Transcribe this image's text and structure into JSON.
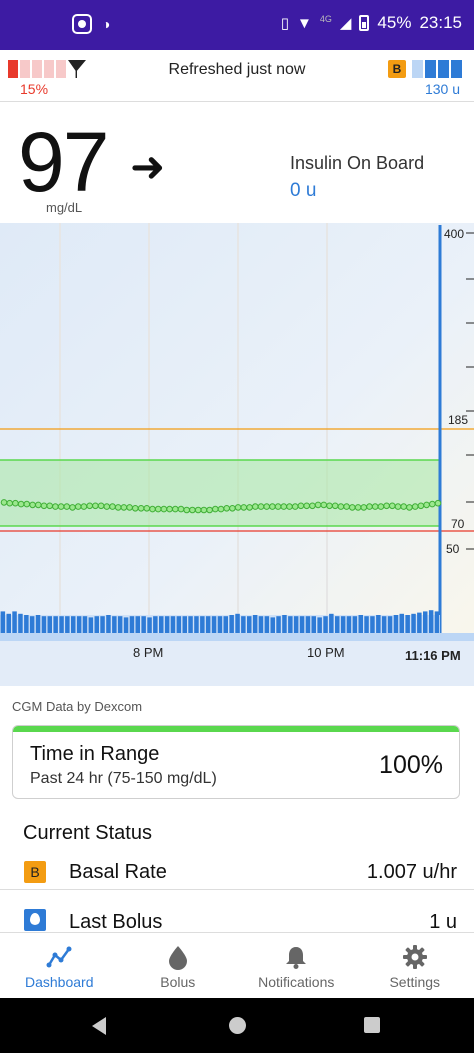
{
  "status_bar": {
    "battery_percent": "45%",
    "time": "23:15",
    "network": "4G"
  },
  "header": {
    "cgm_battery": "15%",
    "refresh_status": "Refreshed just now",
    "basal_badge": "B",
    "insulin_remaining": "130 u"
  },
  "reading": {
    "glucose": "97",
    "unit": "mg/dL",
    "trend_arrow": "➜",
    "iob_label": "Insulin On Board",
    "iob_value": "0 u"
  },
  "chart_data": {
    "type": "line",
    "y_ticks": [
      "400",
      "185",
      "70",
      "50"
    ],
    "x_ticks": [
      "8 PM",
      "10 PM",
      "11:16 PM"
    ],
    "target_high": 185,
    "target_low": 70,
    "glucose_values": [
      98,
      97,
      97,
      96,
      96,
      95,
      95,
      94,
      94,
      93,
      93,
      93,
      92,
      93,
      93,
      94,
      94,
      94,
      93,
      93,
      92,
      92,
      92,
      91,
      91,
      91,
      90,
      90,
      90,
      90,
      90,
      90,
      89,
      89,
      89,
      89,
      89,
      90,
      90,
      91,
      91,
      92,
      92,
      92,
      93,
      93,
      93,
      93,
      93,
      93,
      93,
      93,
      94,
      94,
      94,
      95,
      95,
      94,
      94,
      93,
      93,
      92,
      92,
      92,
      93,
      93,
      93,
      94,
      94,
      93,
      93,
      92,
      93,
      94,
      95,
      96,
      97
    ],
    "basal_bars": [
      0.9,
      0.8,
      0.9,
      0.8,
      0.75,
      0.7,
      0.75,
      0.7,
      0.7,
      0.7,
      0.7,
      0.7,
      0.7,
      0.7,
      0.7,
      0.65,
      0.7,
      0.7,
      0.75,
      0.7,
      0.7,
      0.65,
      0.7,
      0.7,
      0.7,
      0.65,
      0.7,
      0.7,
      0.7,
      0.7,
      0.7,
      0.7,
      0.7,
      0.7,
      0.7,
      0.7,
      0.7,
      0.7,
      0.7,
      0.75,
      0.8,
      0.7,
      0.7,
      0.75,
      0.7,
      0.7,
      0.65,
      0.7,
      0.75,
      0.7,
      0.7,
      0.7,
      0.7,
      0.7,
      0.65,
      0.7,
      0.8,
      0.7,
      0.7,
      0.7,
      0.7,
      0.75,
      0.7,
      0.7,
      0.75,
      0.7,
      0.7,
      0.75,
      0.8,
      0.75,
      0.8,
      0.85,
      0.9,
      0.95,
      0.9
    ]
  },
  "cgm_source": "CGM Data by Dexcom",
  "time_in_range": {
    "title": "Time in Range",
    "subtitle": "Past 24 hr (75-150 mg/dL)",
    "value": "100%"
  },
  "current_status": {
    "title": "Current Status",
    "basal_badge": "B",
    "basal_label": "Basal Rate",
    "basal_value": "1.007 u/hr",
    "bolus_label": "Last Bolus",
    "bolus_value": "1 u"
  },
  "bottom_nav": [
    {
      "label": "Dashboard",
      "icon": "chart-line-icon",
      "active": true
    },
    {
      "label": "Bolus",
      "icon": "drop-icon",
      "active": false
    },
    {
      "label": "Notifications",
      "icon": "bell-icon",
      "active": false
    },
    {
      "label": "Settings",
      "icon": "gear-icon",
      "active": false
    }
  ],
  "colors": {
    "status_bar": "#3d1ba3",
    "accent_blue": "#2e7bd6",
    "target_green": "#5ad84e",
    "high_line": "#f39c12",
    "low_line": "#e8392b"
  }
}
